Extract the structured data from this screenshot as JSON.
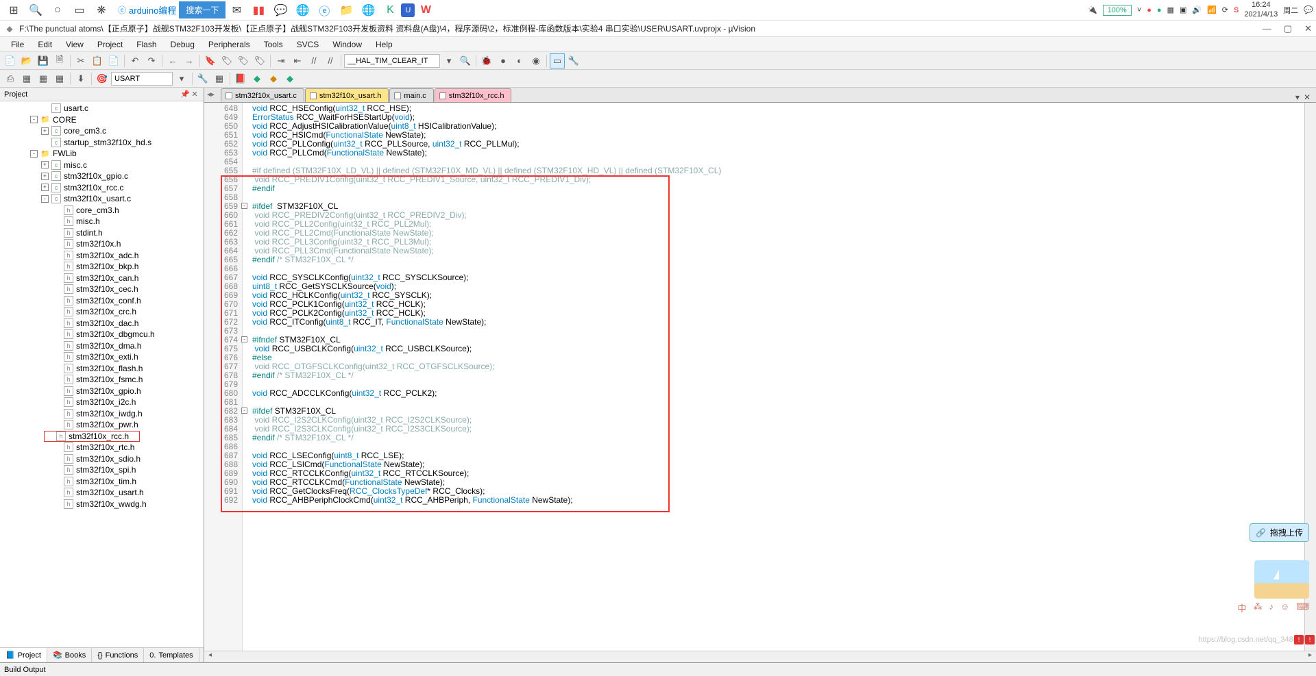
{
  "taskbar": {
    "search_label": "arduino编程",
    "search_btn": "搜索一下",
    "battery": "100%",
    "time": "16:24",
    "date": "2021/4/13",
    "dow": "周二"
  },
  "titlebar": {
    "path": "F:\\The punctual atoms\\【正点原子】战舰STM32F103开发板\\【正点原子】战舰STM32F103开发板资料 资料盘(A盘)\\4，程序源码\\2，标准例程-库函数版本\\实验4 串口实验\\USER\\USART.uvprojx - µVision"
  },
  "menu": [
    "File",
    "Edit",
    "View",
    "Project",
    "Flash",
    "Debug",
    "Peripherals",
    "Tools",
    "SVCS",
    "Window",
    "Help"
  ],
  "toolbar": {
    "find_text": "__HAL_TIM_CLEAR_IT",
    "config_text": "USART"
  },
  "project_panel": {
    "title": "Project",
    "tree": [
      {
        "indent": 2,
        "toggle": "",
        "icon": "file-c",
        "label": "usart.c"
      },
      {
        "indent": 1,
        "toggle": "-",
        "icon": "folder",
        "label": "CORE"
      },
      {
        "indent": 2,
        "toggle": "+",
        "icon": "file-c",
        "label": "core_cm3.c"
      },
      {
        "indent": 2,
        "toggle": "",
        "icon": "file-c",
        "label": "startup_stm32f10x_hd.s"
      },
      {
        "indent": 1,
        "toggle": "-",
        "icon": "folder",
        "label": "FWLib"
      },
      {
        "indent": 2,
        "toggle": "+",
        "icon": "file-c",
        "label": "misc.c"
      },
      {
        "indent": 2,
        "toggle": "+",
        "icon": "file-c",
        "label": "stm32f10x_gpio.c"
      },
      {
        "indent": 2,
        "toggle": "+",
        "icon": "file-c",
        "label": "stm32f10x_rcc.c"
      },
      {
        "indent": 2,
        "toggle": "-",
        "icon": "file-c",
        "label": "stm32f10x_usart.c"
      },
      {
        "indent": 3,
        "toggle": "",
        "icon": "file-h",
        "label": "core_cm3.h"
      },
      {
        "indent": 3,
        "toggle": "",
        "icon": "file-h",
        "label": "misc.h"
      },
      {
        "indent": 3,
        "toggle": "",
        "icon": "file-h",
        "label": "stdint.h"
      },
      {
        "indent": 3,
        "toggle": "",
        "icon": "file-h",
        "label": "stm32f10x.h"
      },
      {
        "indent": 3,
        "toggle": "",
        "icon": "file-h",
        "label": "stm32f10x_adc.h"
      },
      {
        "indent": 3,
        "toggle": "",
        "icon": "file-h",
        "label": "stm32f10x_bkp.h"
      },
      {
        "indent": 3,
        "toggle": "",
        "icon": "file-h",
        "label": "stm32f10x_can.h"
      },
      {
        "indent": 3,
        "toggle": "",
        "icon": "file-h",
        "label": "stm32f10x_cec.h"
      },
      {
        "indent": 3,
        "toggle": "",
        "icon": "file-h",
        "label": "stm32f10x_conf.h"
      },
      {
        "indent": 3,
        "toggle": "",
        "icon": "file-h",
        "label": "stm32f10x_crc.h"
      },
      {
        "indent": 3,
        "toggle": "",
        "icon": "file-h",
        "label": "stm32f10x_dac.h"
      },
      {
        "indent": 3,
        "toggle": "",
        "icon": "file-h",
        "label": "stm32f10x_dbgmcu.h"
      },
      {
        "indent": 3,
        "toggle": "",
        "icon": "file-h",
        "label": "stm32f10x_dma.h"
      },
      {
        "indent": 3,
        "toggle": "",
        "icon": "file-h",
        "label": "stm32f10x_exti.h"
      },
      {
        "indent": 3,
        "toggle": "",
        "icon": "file-h",
        "label": "stm32f10x_flash.h"
      },
      {
        "indent": 3,
        "toggle": "",
        "icon": "file-h",
        "label": "stm32f10x_fsmc.h"
      },
      {
        "indent": 3,
        "toggle": "",
        "icon": "file-h",
        "label": "stm32f10x_gpio.h"
      },
      {
        "indent": 3,
        "toggle": "",
        "icon": "file-h",
        "label": "stm32f10x_i2c.h"
      },
      {
        "indent": 3,
        "toggle": "",
        "icon": "file-h",
        "label": "stm32f10x_iwdg.h"
      },
      {
        "indent": 3,
        "toggle": "",
        "icon": "file-h",
        "label": "stm32f10x_pwr.h"
      },
      {
        "indent": 3,
        "toggle": "",
        "icon": "file-h",
        "label": "stm32f10x_rcc.h",
        "highlight": true
      },
      {
        "indent": 3,
        "toggle": "",
        "icon": "file-h",
        "label": "stm32f10x_rtc.h"
      },
      {
        "indent": 3,
        "toggle": "",
        "icon": "file-h",
        "label": "stm32f10x_sdio.h"
      },
      {
        "indent": 3,
        "toggle": "",
        "icon": "file-h",
        "label": "stm32f10x_spi.h"
      },
      {
        "indent": 3,
        "toggle": "",
        "icon": "file-h",
        "label": "stm32f10x_tim.h"
      },
      {
        "indent": 3,
        "toggle": "",
        "icon": "file-h",
        "label": "stm32f10x_usart.h"
      },
      {
        "indent": 3,
        "toggle": "",
        "icon": "file-h",
        "label": "stm32f10x_wwdg.h"
      }
    ],
    "tabs": [
      {
        "icon": "📘",
        "label": "Project",
        "active": true
      },
      {
        "icon": "📚",
        "label": "Books"
      },
      {
        "icon": "{}",
        "label": "Functions"
      },
      {
        "icon": "0.",
        "label": "Templates"
      }
    ]
  },
  "editor": {
    "tabs": [
      {
        "label": "stm32f10x_usart.c",
        "cls": "gray"
      },
      {
        "label": "stm32f10x_usart.h",
        "cls": "yellow"
      },
      {
        "label": "main.c",
        "cls": "gray"
      },
      {
        "label": "stm32f10x_rcc.h",
        "cls": "pink"
      }
    ],
    "first_line": 648,
    "lines": [
      "<span class='kw-void'>void</span> RCC_HSEConfig(<span class='kw-type'>uint32_t</span> RCC_HSE);",
      "<span class='kw-type'>ErrorStatus</span> RCC_WaitForHSEStartUp(<span class='kw-void'>void</span>);",
      "<span class='kw-void'>void</span> RCC_AdjustHSICalibrationValue(<span class='kw-type'>uint8_t</span> HSICalibrationValue);",
      "<span class='kw-void'>void</span> RCC_HSICmd(<span class='kw-type'>FunctionalState</span> NewState);",
      "<span class='kw-void'>void</span> RCC_PLLConfig(<span class='kw-type'>uint32_t</span> RCC_PLLSource, <span class='kw-type'>uint32_t</span> RCC_PLLMul);",
      "<span class='kw-void'>void</span> RCC_PLLCmd(<span class='kw-type'>FunctionalState</span> NewState);",
      "",
      "<span class='kw-dim'>#if defined (STM32F10X_LD_VL) || defined (STM32F10X_MD_VL) || defined (STM32F10X_HD_VL) || defined (STM32F10X_CL)</span>",
      "<span class='kw-dim'> void RCC_PREDIV1Config(uint32_t RCC_PREDIV1_Source, uint32_t RCC_PREDIV1_Div);</span>",
      "<span class='kw-pp'>#endif</span>",
      "",
      "<span class='kw-pp'>#ifdef</span>  STM32F10X_CL",
      "<span class='kw-dim'> void RCC_PREDIV2Config(uint32_t RCC_PREDIV2_Div);</span>",
      "<span class='kw-dim'> void RCC_PLL2Config(uint32_t RCC_PLL2Mul);</span>",
      "<span class='kw-dim'> void RCC_PLL2Cmd(FunctionalState NewState);</span>",
      "<span class='kw-dim'> void RCC_PLL3Config(uint32_t RCC_PLL3Mul);</span>",
      "<span class='kw-dim'> void RCC_PLL3Cmd(FunctionalState NewState);</span>",
      "<span class='kw-pp'>#endif</span> <span class='kw-dim'>/* STM32F10X_CL */</span>",
      "",
      "<span class='kw-void'>void</span> RCC_SYSCLKConfig(<span class='kw-type'>uint32_t</span> RCC_SYSCLKSource);",
      "<span class='kw-type'>uint8_t</span> RCC_GetSYSCLKSource(<span class='kw-void'>void</span>);",
      "<span class='kw-void'>void</span> RCC_HCLKConfig(<span class='kw-type'>uint32_t</span> RCC_SYSCLK);",
      "<span class='kw-void'>void</span> RCC_PCLK1Config(<span class='kw-type'>uint32_t</span> RCC_HCLK);",
      "<span class='kw-void'>void</span> RCC_PCLK2Config(<span class='kw-type'>uint32_t</span> RCC_HCLK);",
      "<span class='kw-void'>void</span> RCC_ITConfig(<span class='kw-type'>uint8_t</span> RCC_IT, <span class='kw-type'>FunctionalState</span> NewState);",
      "",
      "<span class='kw-pp'>#ifndef</span> STM32F10X_CL",
      " <span class='kw-void'>void</span> RCC_USBCLKConfig(<span class='kw-type'>uint32_t</span> RCC_USBCLKSource);",
      "<span class='kw-pp'>#else</span>",
      "<span class='kw-dim'> void RCC_OTGFSCLKConfig(uint32_t RCC_OTGFSCLKSource);</span>",
      "<span class='kw-pp'>#endif</span> <span class='kw-dim'>/* STM32F10X_CL */</span>",
      "",
      "<span class='kw-void'>void</span> RCC_ADCCLKConfig(<span class='kw-type'>uint32_t</span> RCC_PCLK2);",
      "",
      "<span class='kw-pp'>#ifdef</span> STM32F10X_CL",
      "<span class='kw-dim'> void RCC_I2S2CLKConfig(uint32_t RCC_I2S2CLKSource);</span>",
      "<span class='kw-dim'> void RCC_I2S3CLKConfig(uint32_t RCC_I2S3CLKSource);</span>",
      "<span class='kw-pp'>#endif</span> <span class='kw-dim'>/* STM32F10X_CL */</span>",
      "",
      "<span class='kw-void'>void</span> RCC_LSEConfig(<span class='kw-type'>uint8_t</span> RCC_LSE);",
      "<span class='kw-void'>void</span> RCC_LSICmd(<span class='kw-type'>FunctionalState</span> NewState);",
      "<span class='kw-void'>void</span> RCC_RTCCLKConfig(<span class='kw-type'>uint32_t</span> RCC_RTCCLKSource);",
      "<span class='kw-void'>void</span> RCC_RTCCLKCmd(<span class='kw-type'>FunctionalState</span> NewState);",
      "<span class='kw-void'>void</span> RCC_GetClocksFreq(<span class='kw-type'>RCC_ClocksTypeDef</span>* RCC_Clocks);",
      "<span class='kw-void'>void</span> RCC_AHBPeriphClockCmd(<span class='kw-type'>uint32_t</span> RCC_AHBPeriph, <span class='kw-type'>FunctionalState</span> NewState);"
    ],
    "fold_lines": [
      659,
      674,
      682
    ]
  },
  "build_output": "Build Output",
  "float_upload": "拖拽上传",
  "watermark": "https://blog.csdn.net/qq_34848晕"
}
